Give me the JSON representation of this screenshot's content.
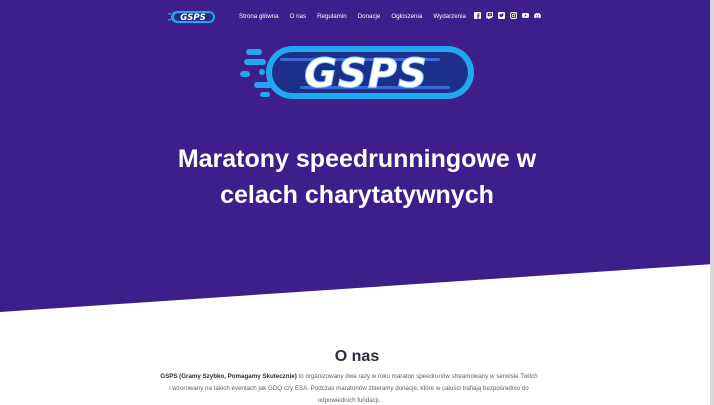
{
  "brand": {
    "logo_text": "GSPS"
  },
  "nav": {
    "links": [
      "Strona główna",
      "O nas",
      "Regulamin",
      "Donacje",
      "Ogłoszenia",
      "Wydarzenia"
    ],
    "socials": [
      "facebook-icon",
      "twitch-icon",
      "twitter-icon",
      "instagram-icon",
      "youtube-icon",
      "discord-icon"
    ]
  },
  "hero": {
    "logo_text": "GSPS",
    "title_line1": "Maratony speedrunningowe w",
    "title_line2": "celach charytatywnych"
  },
  "about": {
    "title": "O nas",
    "text_bold": "GSPS (Gramy Szybko, Pomagamy Skutecznie)",
    "text_rest": " to organizowany dwa razy w roku maraton speedrunów streamowany w serwisie Twitch i wzorowany na takich eventach jak GDQ czy ESA. Podczas maratonów zbieramy donacje, które w całości trafiają bezpośrednio do odpowiednich fundacji."
  },
  "colors": {
    "hero_bg": "#3e1e8a",
    "logo_blue": "#20a8f0",
    "logo_dark": "#1d2f8a",
    "heading_dark": "#2b2e3e"
  }
}
